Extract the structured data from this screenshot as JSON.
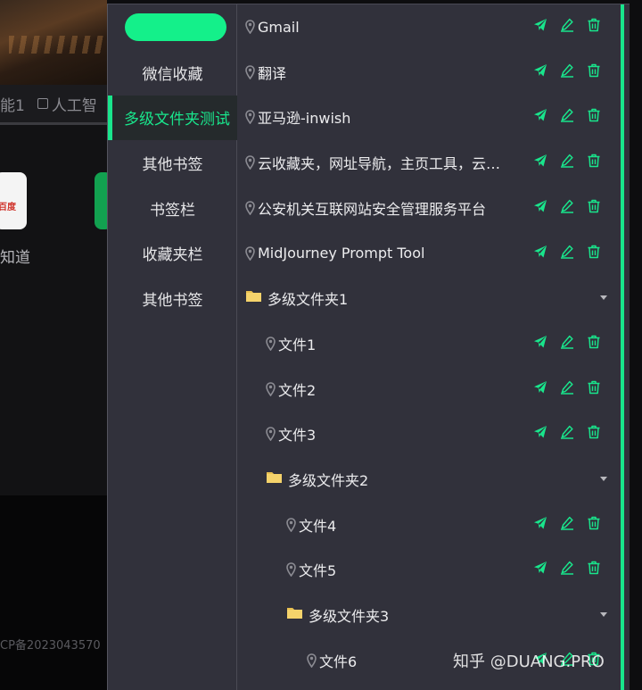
{
  "background_page": {
    "tabs": [
      "能1",
      "人工智"
    ],
    "tile_label": "知道",
    "tile_logo_text": "百度",
    "footer_text": "CP备2023043570"
  },
  "sidebar": {
    "items": [
      {
        "label": "微信收藏",
        "active": false
      },
      {
        "label": "多级文件夹测试",
        "active": true
      },
      {
        "label": "其他书签",
        "active": false
      },
      {
        "label": "书签栏",
        "active": false
      },
      {
        "label": "收藏夹栏",
        "active": false
      },
      {
        "label": "其他书签",
        "active": false
      }
    ]
  },
  "bookmarks": [
    {
      "type": "link",
      "name": "Gmail",
      "level": 0
    },
    {
      "type": "link",
      "name": "翻译",
      "level": 0
    },
    {
      "type": "link",
      "name": "亚马逊-inwish",
      "level": 0
    },
    {
      "type": "link",
      "name": "云收藏夹，网址导航，主页工具，云书签",
      "level": 0
    },
    {
      "type": "link",
      "name": "公安机关互联网站安全管理服务平台",
      "level": 0
    },
    {
      "type": "link",
      "name": "MidJourney Prompt Tool",
      "level": 0
    },
    {
      "type": "folder",
      "name": "多级文件夹1",
      "level": 0
    },
    {
      "type": "link",
      "name": "文件1",
      "level": 1
    },
    {
      "type": "link",
      "name": "文件2",
      "level": 1
    },
    {
      "type": "link",
      "name": "文件3",
      "level": 1
    },
    {
      "type": "folder",
      "name": "多级文件夹2",
      "level": 1
    },
    {
      "type": "link",
      "name": "文件4",
      "level": 2
    },
    {
      "type": "link",
      "name": "文件5",
      "level": 2
    },
    {
      "type": "folder",
      "name": "多级文件夹3",
      "level": 2
    },
    {
      "type": "link",
      "name": "文件6",
      "level": 3
    }
  ],
  "watermark": "知乎 @DUANG.PRO",
  "colors": {
    "accent": "#19e58c",
    "panel_bg": "#31313b",
    "folder": "#f5d36b",
    "pin": "#8b8b92"
  },
  "icons": {
    "link": "map-pin-icon",
    "folder": "folder-icon",
    "open": "send-icon",
    "edit": "edit-icon",
    "delete": "trash-icon",
    "expand": "caret-down-icon"
  }
}
